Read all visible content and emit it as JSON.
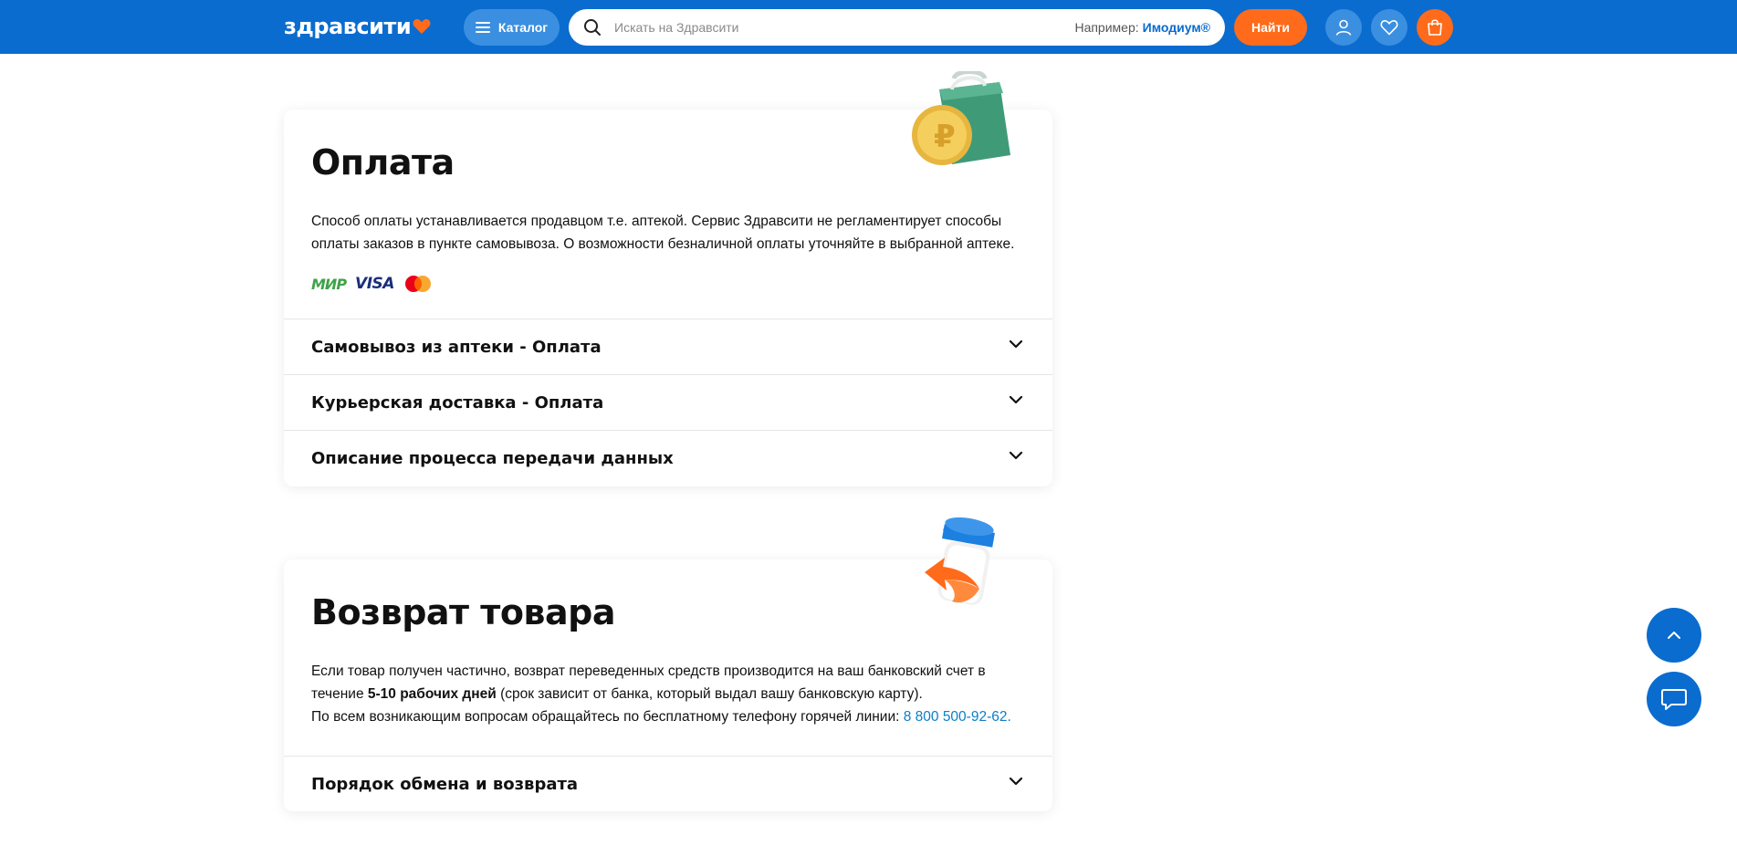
{
  "header": {
    "logo_text": "здравсити",
    "catalog_label": "Каталог",
    "search_placeholder": "Искать на Здравсити",
    "example_prefix": "Например:",
    "example_value": "Имодиум®",
    "find_label": "Найти",
    "brand_color": "#0a6ccf",
    "accent_color": "#ff6b1a"
  },
  "payment": {
    "title": "Оплата",
    "text": "Способ оплаты устанавливается продавцом т.е. аптекой. Сервис Здравсити не регламентирует способы оплаты заказов в пункте самовывоза. О возможности безналичной оплаты уточняйте в выбранной аптеке.",
    "logos": [
      "МИР",
      "VISA"
    ],
    "accordion": [
      {
        "label": "Самовывоз из аптеки - Оплата"
      },
      {
        "label": "Курьерская доставка - Оплата"
      },
      {
        "label": "Описание процесса передачи данных"
      }
    ]
  },
  "returns": {
    "title": "Возврат товара",
    "text_before_bold": "Если товар получен частично, возврат переведенных средств производится на ваш банковский счет в течение ",
    "text_bold": "5-10 рабочих дней",
    "text_after_bold": " (срок зависит от банка, который выдал вашу банковскую карту).",
    "hotline_text": "По всем возникающим вопросам обращайтесь по бесплатному телефону горячей линии: ",
    "hotline_phone": "8 800 500-92-62.",
    "accordion": [
      {
        "label": "Порядок обмена и возврата"
      }
    ]
  }
}
